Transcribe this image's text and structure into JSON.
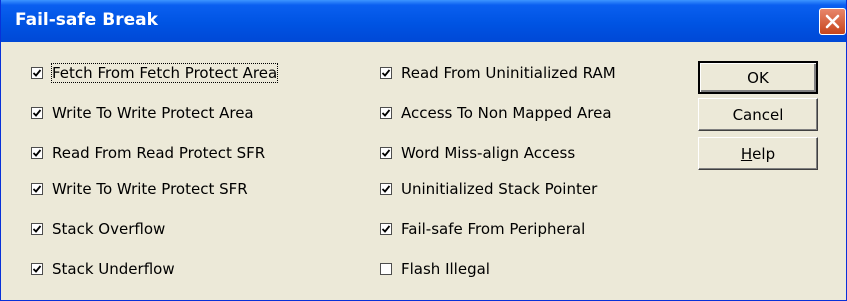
{
  "window": {
    "title": "Fail-safe Break"
  },
  "left_column": [
    {
      "label": "Fetch From Fetch Protect Area",
      "checked": true,
      "focused": true
    },
    {
      "label": "Write To Write Protect Area",
      "checked": true
    },
    {
      "label": "Read From Read Protect SFR",
      "checked": true
    },
    {
      "label": "Write To Write Protect SFR",
      "checked": true
    },
    {
      "label": "Stack Overflow",
      "checked": true
    },
    {
      "label": "Stack Underflow",
      "checked": true
    }
  ],
  "right_column": [
    {
      "label": "Read From Uninitialized RAM",
      "checked": true
    },
    {
      "label": "Access To Non Mapped Area",
      "checked": true
    },
    {
      "label": "Word Miss-align Access",
      "checked": true
    },
    {
      "label": "Uninitialized Stack Pointer",
      "checked": true
    },
    {
      "label": "Fail-safe From Peripheral",
      "checked": true
    },
    {
      "label": "Flash Illegal",
      "checked": false
    }
  ],
  "buttons": {
    "ok_label": "OK",
    "cancel_label": "Cancel",
    "help_label_underlined": "H",
    "help_label_rest": "elp"
  }
}
